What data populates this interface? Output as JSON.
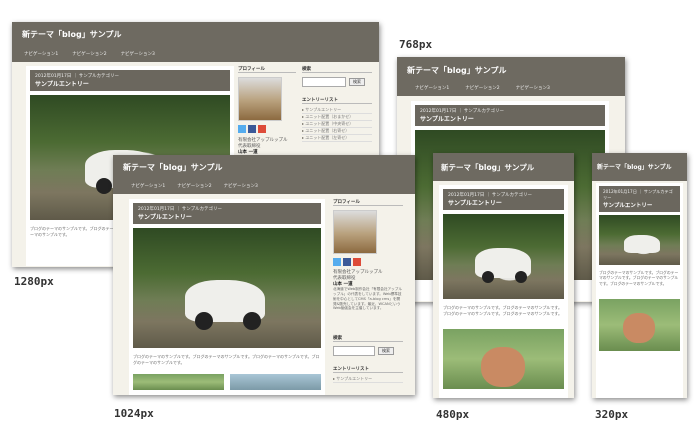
{
  "site_title": "新テーマ「blog」サンプル",
  "nav": [
    "ナビゲーション1",
    "ナビゲーション2",
    "ナビゲーション3"
  ],
  "post": {
    "date": "2012年01月17日",
    "category": "サンプルカテゴリー",
    "title": "サンプルエントリー",
    "body": "ブログのテーマのサンプルです。ブログのテーマのサンプルです。ブログのテーマのサンプルです。ブログのテーマのサンプルです。"
  },
  "sidebar": {
    "profile_heading": "プロフィール",
    "company": "有限会社アップルップル",
    "position": "代表取締役",
    "person": "山本 一道",
    "bio": "北海道でWeb制作会社「有限会社アップルップル」の代表をしています。Web標準技術を中心としてCMS「a-blog cms」を開発&販売しています。最近、WCANというWeb勉強会を主催しています。",
    "search_heading": "検索",
    "search_button": "検索",
    "entries_heading": "エントリーリスト",
    "entries": [
      "サンプルエントリー",
      "ユニット配置（おまかせ）",
      "ユニット配置（中央寄せ）",
      "ユニット配置（右寄せ）",
      "ユニット配置（左寄せ）"
    ]
  },
  "labels": {
    "w1280": "1280px",
    "w1024": "1024px",
    "w768": "768px",
    "w480": "480px",
    "w320": "320px"
  }
}
